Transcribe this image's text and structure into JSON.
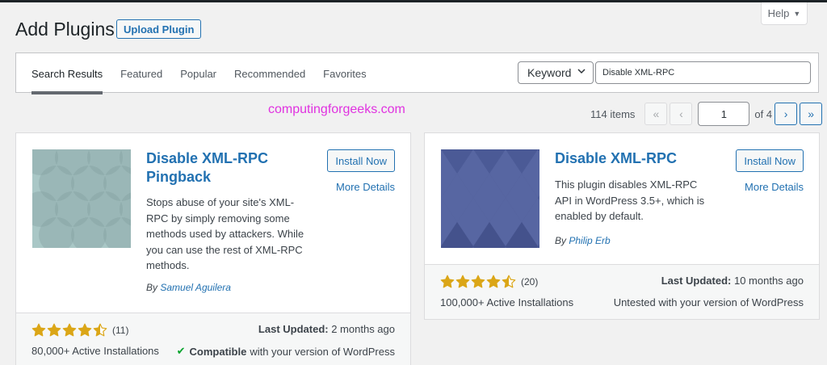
{
  "header": {
    "title": "Add Plugins",
    "upload_label": "Upload Plugin",
    "help_label": "Help"
  },
  "filter": {
    "tabs": [
      {
        "label": "Search Results",
        "current": true
      },
      {
        "label": "Featured"
      },
      {
        "label": "Popular"
      },
      {
        "label": "Recommended"
      },
      {
        "label": "Favorites"
      }
    ],
    "search_type": "Keyword",
    "search_value": "Disable XML-RPC"
  },
  "watermark": "computingforgeeks.com",
  "pagination": {
    "count": "114 items",
    "first": "«",
    "prev": "‹",
    "current_page": "1",
    "of_label": "of 4",
    "next": "›",
    "last": "»"
  },
  "plugins": [
    {
      "name": "Disable XML-RPC Pingback",
      "install_label": "Install Now",
      "details_label": "More Details",
      "description": "Stops abuse of your site's XML-RPC by simply removing some methods used by attackers. While you can use the rest of XML-RPC methods.",
      "author_prefix": "By",
      "author": "Samuel Aguilera",
      "rating": 4.5,
      "rating_count": "(11)",
      "installs": "80,000+ Active Installations",
      "updated_label": "Last Updated:",
      "updated_value": "2 months ago",
      "compat_strong": "Compatible",
      "compat_rest": "with your version of WordPress",
      "thumb_color": "#9fbfbf"
    },
    {
      "name": "Disable XML-RPC",
      "install_label": "Install Now",
      "details_label": "More Details",
      "description": "This plugin disables XML-RPC API in WordPress 3.5+, which is enabled by default.",
      "author_prefix": "By",
      "author": "Philip Erb",
      "rating": 4.5,
      "rating_count": "(20)",
      "installs": "100,000+ Active Installations",
      "updated_label": "Last Updated:",
      "updated_value": "10 months ago",
      "compat_text": "Untested with your version of WordPress",
      "thumb_color": "#4a5a96"
    }
  ],
  "colors": {
    "accent": "#2271b1",
    "star": "#dba617",
    "compatible": "#00a32a"
  }
}
